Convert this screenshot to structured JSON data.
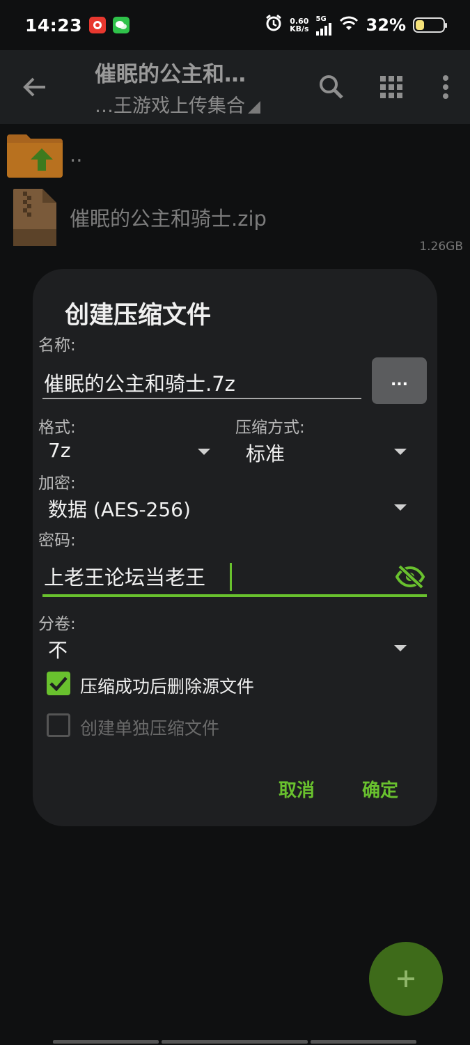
{
  "status_bar": {
    "time": "14:23",
    "net_speed_value": "0.60",
    "net_speed_unit": "KB/s",
    "network_type": "5G",
    "battery_percent": "32%",
    "battery_level": 0.32
  },
  "toolbar": {
    "title": "催眠的公主和…",
    "subtitle": "…王游戏上传集合"
  },
  "files": [
    {
      "name": "..",
      "size": ""
    },
    {
      "name": "催眠的公主和骑士.zip",
      "size": "1.26GB",
      "icon_text": "ZIP"
    }
  ],
  "dialog": {
    "title": "创建压缩文件",
    "name_label": "名称:",
    "name_value": "催眠的公主和骑士.7z",
    "browse_label": "...",
    "format_label": "格式:",
    "format_value": "7z",
    "method_label": "压缩方式:",
    "method_value": "标准",
    "encryption_label": "加密:",
    "encryption_value": "数据 (AES-256)",
    "password_label": "密码:",
    "password_value": "上老王论坛当老王",
    "split_label": "分卷:",
    "split_value": "不",
    "delete_after_label": "压缩成功后删除源文件",
    "delete_after_checked": true,
    "separate_label": "创建单独压缩文件",
    "separate_checked": false,
    "cancel_label": "取消",
    "ok_label": "确定"
  },
  "colors": {
    "accent": "#69c12e",
    "dialog_bg": "#1e1f21",
    "fab": "#3e6b1a"
  },
  "icons": [
    "back-arrow-icon",
    "search-icon",
    "grid-view-icon",
    "more-vert-icon",
    "folder-up-icon",
    "zip-file-icon",
    "eye-off-icon",
    "check-icon",
    "plus-icon",
    "alarm-icon",
    "wifi-icon",
    "signal-icon",
    "battery-icon"
  ]
}
